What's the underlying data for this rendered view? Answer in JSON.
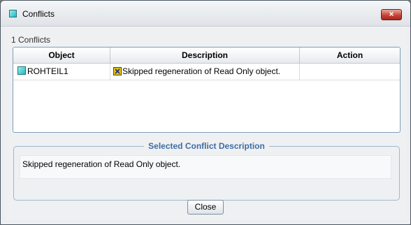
{
  "window": {
    "title": "Conflicts",
    "close_glyph": "×"
  },
  "summary": {
    "count_text": "1 Conflicts"
  },
  "table": {
    "columns": [
      "Object",
      "Description",
      "Action"
    ],
    "rows": [
      {
        "object": "ROHTEIL1",
        "description": "Skipped regeneration of Read Only object.",
        "action": "",
        "object_icon": "part-icon",
        "description_icon": "warning-icon"
      }
    ]
  },
  "details": {
    "legend": "Selected Conflict Description",
    "text": "Skipped regeneration of Read Only object."
  },
  "buttons": {
    "close_label": "Close"
  },
  "colors": {
    "legend_text": "#3d6ea6",
    "close_button_red": "#c8443a",
    "table_border": "#7f9db9"
  }
}
